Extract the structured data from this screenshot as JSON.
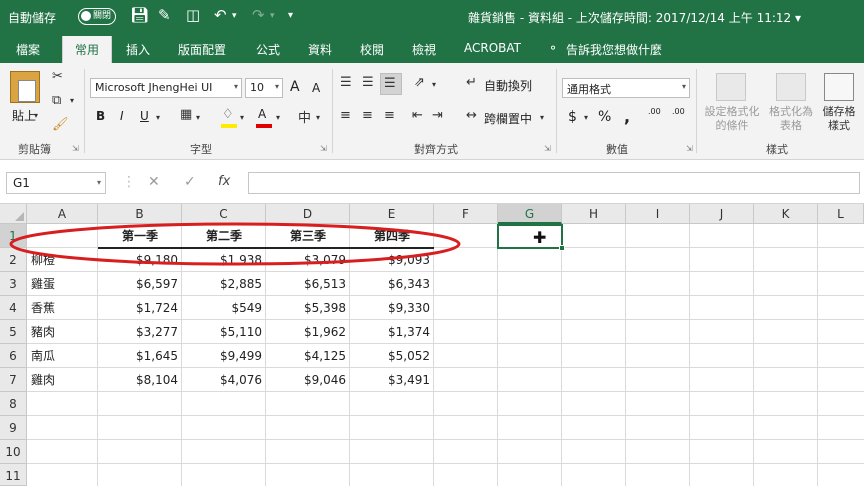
{
  "titlebar": {
    "autosave_label": "自動儲存",
    "autosave_state": "關閉",
    "doc_title": "雜貨銷售 - 資料組 - 上次儲存時間: 2017/12/14 上午 11:12 ▾"
  },
  "tabs": [
    "檔案",
    "常用",
    "插入",
    "版面配置",
    "公式",
    "資料",
    "校閱",
    "檢視",
    "ACROBAT",
    "告訴我您想做什麼"
  ],
  "active_tab": "常用",
  "ribbon": {
    "clipboard": {
      "paste_label": "貼上",
      "group_label": "剪貼簿"
    },
    "font": {
      "font_name": "Microsoft JhengHei UI",
      "font_size": "10",
      "group_label": "字型",
      "bold": "B",
      "italic": "I",
      "underline": "U",
      "grow": "A",
      "shrink": "A"
    },
    "alignment": {
      "wrap_text": "自動換列",
      "merge_center": "跨欄置中",
      "group_label": "對齊方式"
    },
    "number": {
      "format": "通用格式",
      "group_label": "數值",
      "currency": "$",
      "percent": "%",
      "comma": ",",
      "inc_decimal": ".00",
      "dec_decimal": ".00"
    },
    "styles": {
      "conditional": "設定格式化\n的條件",
      "format_table": "格式化為\n表格",
      "cell_styles": "儲存格\n樣式",
      "group_label": "樣式"
    }
  },
  "formula_bar": {
    "name_box": "G1",
    "fx": "fx",
    "value": ""
  },
  "sheet": {
    "columns": [
      "A",
      "B",
      "C",
      "D",
      "E",
      "F",
      "G",
      "H",
      "I",
      "J",
      "K",
      "L"
    ],
    "rows": [
      "1",
      "2",
      "3",
      "4",
      "5",
      "6",
      "7",
      "8",
      "9",
      "10",
      "11"
    ],
    "selected_column": "G",
    "headers": [
      "第一季",
      "第二季",
      "第三季",
      "第四季"
    ],
    "data": [
      {
        "item": "柳橙",
        "values": [
          "$9,180",
          "$1,938",
          "$3,079",
          "$9,093"
        ]
      },
      {
        "item": "雞蛋",
        "values": [
          "$6,597",
          "$2,885",
          "$6,513",
          "$6,343"
        ]
      },
      {
        "item": "香蕉",
        "values": [
          "$1,724",
          "$549",
          "$5,398",
          "$9,330"
        ]
      },
      {
        "item": "豬肉",
        "values": [
          "$3,277",
          "$5,110",
          "$1,962",
          "$1,374"
        ]
      },
      {
        "item": "南瓜",
        "values": [
          "$1,645",
          "$9,499",
          "$4,125",
          "$5,052"
        ]
      },
      {
        "item": "雞肉",
        "values": [
          "$8,104",
          "$4,076",
          "$9,046",
          "$3,491"
        ]
      }
    ]
  },
  "colors": {
    "excel_green": "#217346",
    "annotation_red": "#d81e1e"
  }
}
